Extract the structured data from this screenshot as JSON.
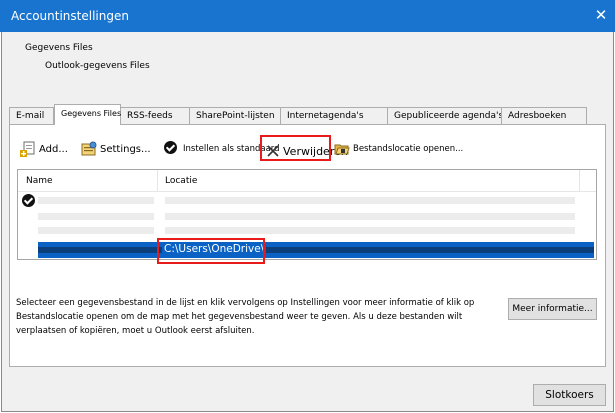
{
  "window": {
    "title": "Accountinstellingen",
    "close_glyph": "✕"
  },
  "header": {
    "heading": "Gegevens Files",
    "subheading": "Outlook-gegevens Files"
  },
  "tabs": [
    {
      "label": "E-mail",
      "active": false
    },
    {
      "label": "Gegevens Files",
      "active": true
    },
    {
      "label": "RSS-feeds",
      "active": false
    },
    {
      "label": "SharePoint-lijsten",
      "active": false
    },
    {
      "label": "Internetagenda's",
      "active": false
    },
    {
      "label": "Gepubliceerde agenda's",
      "active": false
    },
    {
      "label": "Adresboeken",
      "active": false
    }
  ],
  "toolbar": {
    "add_label": "Add...",
    "settings_label": "Settings...",
    "default_label": "Instellen als standaard",
    "delete_label": "Verwijderen",
    "location_label": "Bestandslocatie openen..."
  },
  "list": {
    "col_name": "Name",
    "col_location": "Locatie",
    "selected_location": "C:\\Users\\OneDrive\\"
  },
  "info": {
    "text": "Selecteer een gegevensbestand in de lijst en klik vervolgens op Instellingen voor meer informatie of klik op Bestandslocatie openen om de map met het gegevensbestand weer te geven. Als u deze bestanden wilt verplaatsen of kopiëren, moet u Outlook eerst afsluiten.",
    "more_button": "Meer informatie..."
  },
  "footer": {
    "close_button": "Slotkoers"
  },
  "colors": {
    "titlebar": "#1874cf",
    "selection": "#0a63c4",
    "highlight": "#e81a1a"
  },
  "icons": {
    "add": "add-file-icon",
    "settings": "settings-icon",
    "default": "checkmark-icon",
    "delete": "delete-x-icon",
    "location": "folder-open-icon"
  }
}
